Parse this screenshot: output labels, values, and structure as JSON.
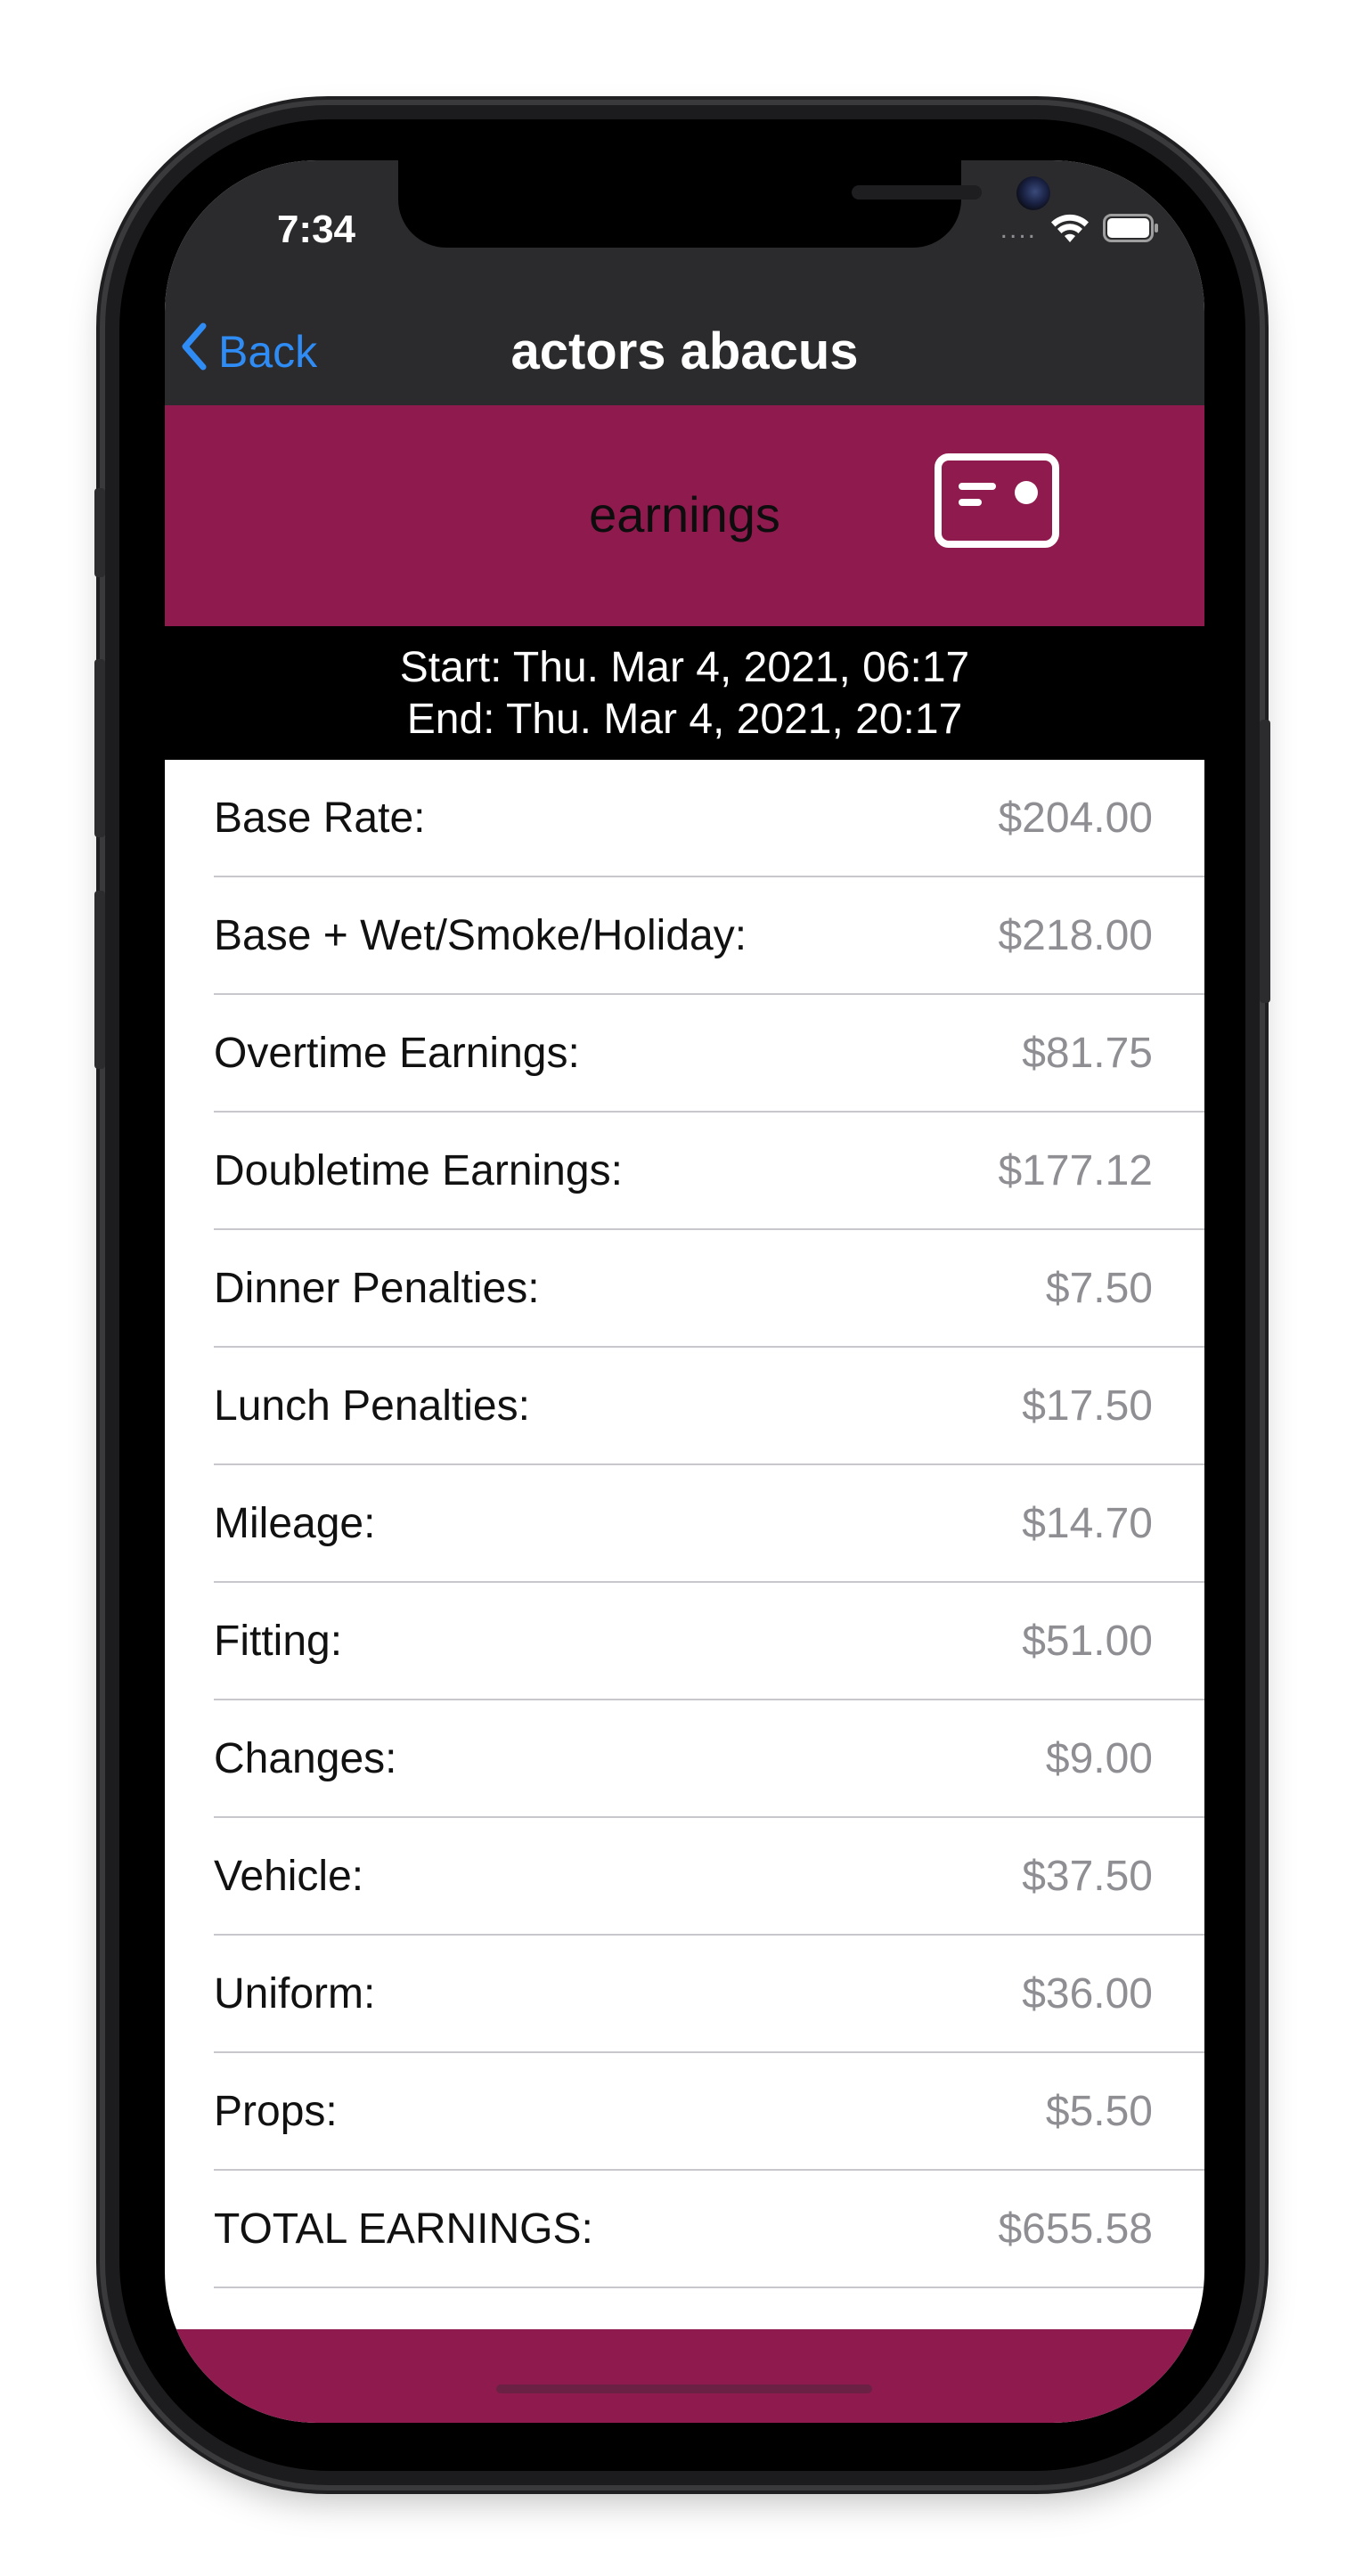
{
  "status_bar": {
    "time": "7:34",
    "signal": "....",
    "icons": [
      "wifi-icon",
      "battery-icon"
    ]
  },
  "nav": {
    "back_label": "Back",
    "title": "actors abacus",
    "back_icon": "chevron-left-icon"
  },
  "header": {
    "title": "earnings",
    "card_icon": "card-icon"
  },
  "dates": {
    "start": "Start: Thu. Mar 4, 2021, 06:17",
    "end": "End: Thu. Mar 4, 2021, 20:17"
  },
  "rows": [
    {
      "label": "Base Rate:",
      "value": "$204.00"
    },
    {
      "label": "Base + Wet/Smoke/Holiday:",
      "value": "$218.00"
    },
    {
      "label": "Overtime Earnings:",
      "value": "$81.75"
    },
    {
      "label": "Doubletime Earnings:",
      "value": "$177.12"
    },
    {
      "label": "Dinner Penalties:",
      "value": "$7.50"
    },
    {
      "label": "Lunch Penalties:",
      "value": "$17.50"
    },
    {
      "label": "Mileage:",
      "value": "$14.70"
    },
    {
      "label": "Fitting:",
      "value": "$51.00"
    },
    {
      "label": "Changes:",
      "value": "$9.00"
    },
    {
      "label": "Vehicle:",
      "value": "$37.50"
    },
    {
      "label": "Uniform:",
      "value": "$36.00"
    },
    {
      "label": "Props:",
      "value": "$5.50"
    },
    {
      "label": "TOTAL EARNINGS:",
      "value": "$655.58"
    }
  ],
  "colors": {
    "accent": "#8f1b4e",
    "nav_background": "#2b2b2d",
    "link": "#2f8cf5",
    "value_text": "#8e8e93"
  }
}
